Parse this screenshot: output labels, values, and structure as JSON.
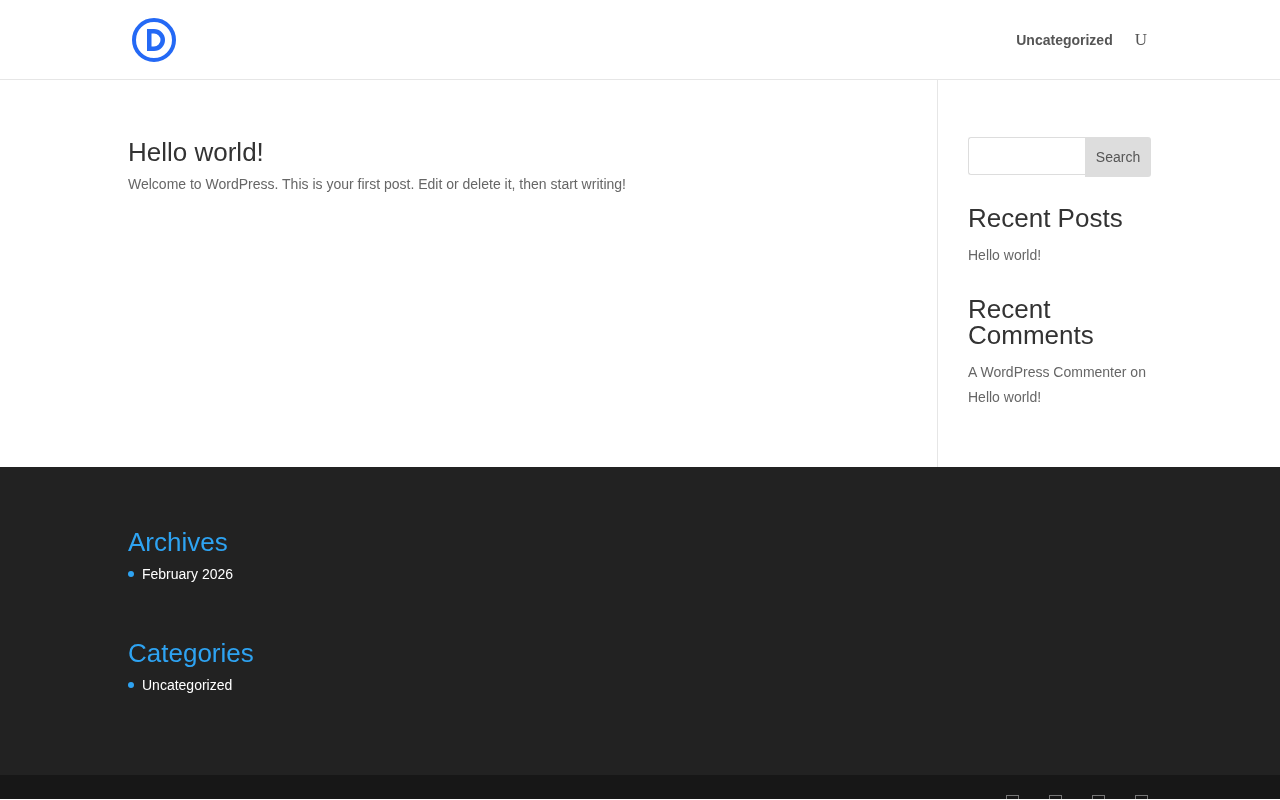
{
  "header": {
    "nav": [
      {
        "label": "Uncategorized"
      }
    ],
    "search_glyph": "U"
  },
  "post": {
    "title": "Hello world!",
    "excerpt": "Welcome to WordPress. This is your first post. Edit or delete it, then start writing!"
  },
  "sidebar": {
    "search": {
      "button": "Search"
    },
    "recent_posts": {
      "title": "Recent Posts",
      "items": [
        "Hello world!"
      ]
    },
    "recent_comments": {
      "title": "Recent Comments",
      "items": [
        {
          "author": "A WordPress Commenter",
          "joiner": "on",
          "post": "Hello world!"
        }
      ]
    }
  },
  "footer_widgets": [
    {
      "title": "Archives",
      "items": [
        "February 2026"
      ]
    },
    {
      "title": "Categories",
      "items": [
        "Uncategorized"
      ]
    }
  ]
}
